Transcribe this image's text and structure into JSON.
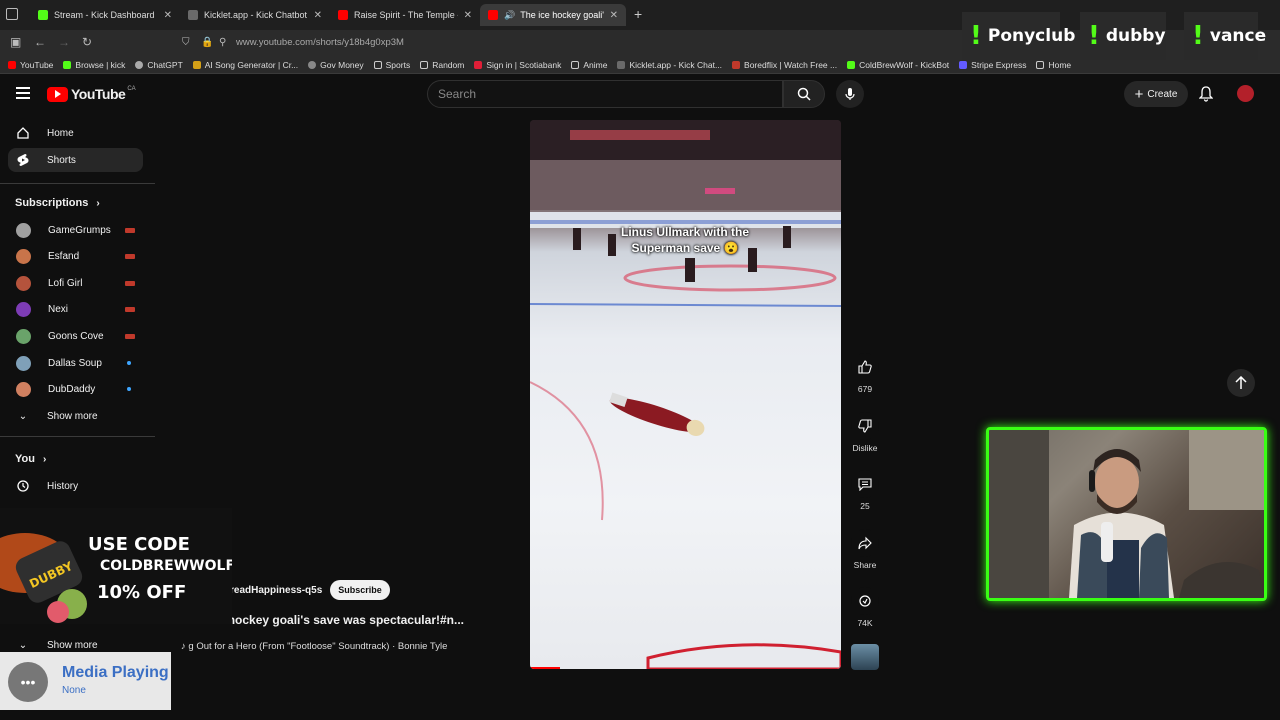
{
  "browser": {
    "tabs": [
      {
        "label": "Stream - Kick Dashboard",
        "color": "#53fc18"
      },
      {
        "label": "Kicklet.app - Kick Chatbot and C",
        "color": "#6a6a6a"
      },
      {
        "label": "Raise Spirit - The Temple - YouT",
        "color": "#ff0000"
      },
      {
        "label": "The ice hockey goali's save",
        "color": "#ff0000"
      }
    ],
    "new_tab": "+",
    "url": "www.youtube.com/shorts/y18b4g0xp3M",
    "bookmarks": [
      {
        "label": "YouTube",
        "color": "#ff0000"
      },
      {
        "label": "Browse | kick",
        "color": "#53fc18"
      },
      {
        "label": "ChatGPT",
        "color": "#aaaaaa"
      },
      {
        "label": "AI Song Generator | Cr...",
        "color": "#d4a017"
      },
      {
        "label": "Gov Money",
        "color": "#888888"
      },
      {
        "label": "Sports",
        "color": "#e6b800"
      },
      {
        "label": "Random",
        "color": "#e6b800"
      },
      {
        "label": "Sign in | Scotiabank",
        "color": "#e01e37"
      },
      {
        "label": "Anime",
        "color": "#e6b800"
      },
      {
        "label": "Kicklet.app - Kick Chat...",
        "color": "#6a6a6a"
      },
      {
        "label": "Boredflix | Watch Free ...",
        "color": "#c0392b"
      },
      {
        "label": "ColdBrewWolf - KickBot",
        "color": "#53fc18"
      },
      {
        "label": "Stripe Express",
        "color": "#635bff"
      },
      {
        "label": "Home",
        "color": "#e6b800"
      }
    ]
  },
  "overlay_names": [
    "Ponyclub",
    "dubby",
    "vance"
  ],
  "youtube": {
    "logo_text": "YouTube",
    "region": "CA",
    "search_placeholder": "Search",
    "create_label": "Create"
  },
  "sidebar": {
    "main": [
      {
        "label": "Home"
      },
      {
        "label": "Shorts"
      }
    ],
    "subscriptions_heading": "Subscriptions",
    "subscriptions": [
      {
        "label": "GameGrumps",
        "status": "live",
        "color": "#a0a0a0"
      },
      {
        "label": "Esfand",
        "status": "live",
        "color": "#c8744a"
      },
      {
        "label": "Lofi Girl",
        "status": "live",
        "color": "#b5533c"
      },
      {
        "label": "Nexi",
        "status": "live",
        "color": "#7d3cb5"
      },
      {
        "label": "Goons Cove",
        "status": "live",
        "color": "#6aa36a"
      },
      {
        "label": "Dallas Soup",
        "status": "new",
        "color": "#7fa0b8"
      },
      {
        "label": "DubDaddy",
        "status": "new",
        "color": "#d08060"
      }
    ],
    "show_more_1": "Show more",
    "you_heading": "You",
    "you_items": [
      {
        "label": "History"
      }
    ],
    "show_more_2": "Show more"
  },
  "short": {
    "caption_line1": "Linus Ullmark with the",
    "caption_line2": "Superman save 😮",
    "channel": "readHappiness-q5s",
    "subscribe": "Subscribe",
    "title": "hockey goali's save was spectacular!#n...",
    "title_prefix": "The ice ",
    "music": "g Out for a Hero (From \"Footloose\" Soundtrack) · Bonnie Tyle"
  },
  "actions": {
    "likes": "679",
    "dislike": "Dislike",
    "comments": "25",
    "share": "Share",
    "remix": "74K"
  },
  "promo": {
    "line1": "USE CODE",
    "line2": "COLDBREWWOLF",
    "line3": "10% OFF",
    "product": "DUBBY"
  },
  "media_widget": {
    "title": "Media Playing",
    "subtitle": "None"
  },
  "colors": {
    "accent_green": "#39ff14",
    "yt_red": "#ff0000",
    "background": "#0f0f0f"
  }
}
